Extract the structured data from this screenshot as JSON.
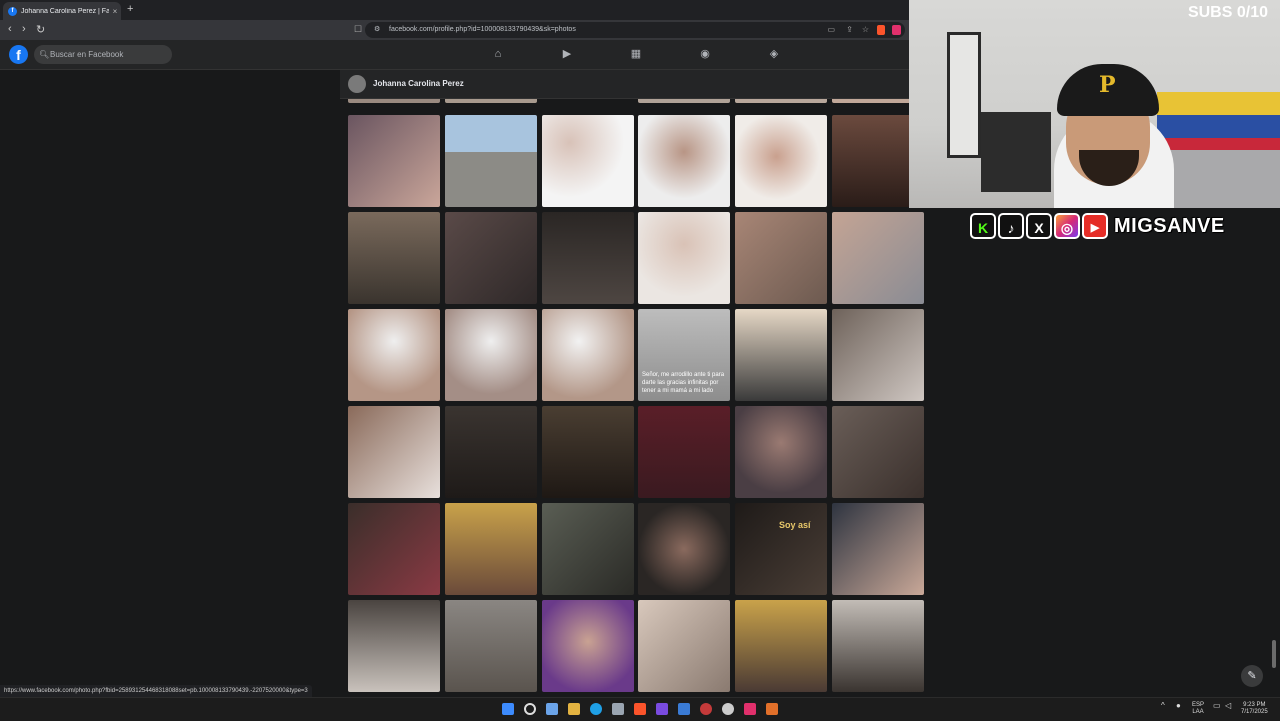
{
  "browser": {
    "tab_title": "Johanna Carolina Perez | Facebo",
    "tab_close": "×",
    "new_tab": "+",
    "url": "facebook.com/profile.php?id=100008133790439&sk=photos",
    "back": "‹",
    "forward": "›",
    "reload": "↻",
    "status_url": "https://www.facebook.com/photo.php?fbid=258931254468318088set=pb.100008133790439.-2207520000&type=3"
  },
  "facebook": {
    "logo": "f",
    "search_placeholder": "Buscar en Facebook",
    "nav_icons": [
      "home-icon",
      "video-icon",
      "marketplace-icon",
      "groups-icon",
      "gaming-icon"
    ],
    "profile_name": "Johanna Carolina Perez",
    "photo_captions": {
      "r2c3": "Señor, me arrodillo ante ti para darte las gracias infinitas por tener a mi mamá a mi lado",
      "r4c4": "Soy así"
    }
  },
  "overlay": {
    "subs": "SUBS 0/10",
    "social_icons": [
      "kick-icon",
      "tiktok-icon",
      "x-icon",
      "instagram-icon",
      "youtube-icon"
    ],
    "kick": "K",
    "tiktok": "♪",
    "x": "X",
    "instagram": "◎",
    "youtube": "▶",
    "handle": "MIGSANVE",
    "cap_letter": "P"
  },
  "taskbar": {
    "lang_top": "ESP",
    "lang_bottom": "LAA",
    "time": "9:23 PM",
    "date": "7/17/2025"
  },
  "colors": {
    "fb_blue": "#1877f2",
    "bg": "#18191a",
    "header": "#242526"
  }
}
